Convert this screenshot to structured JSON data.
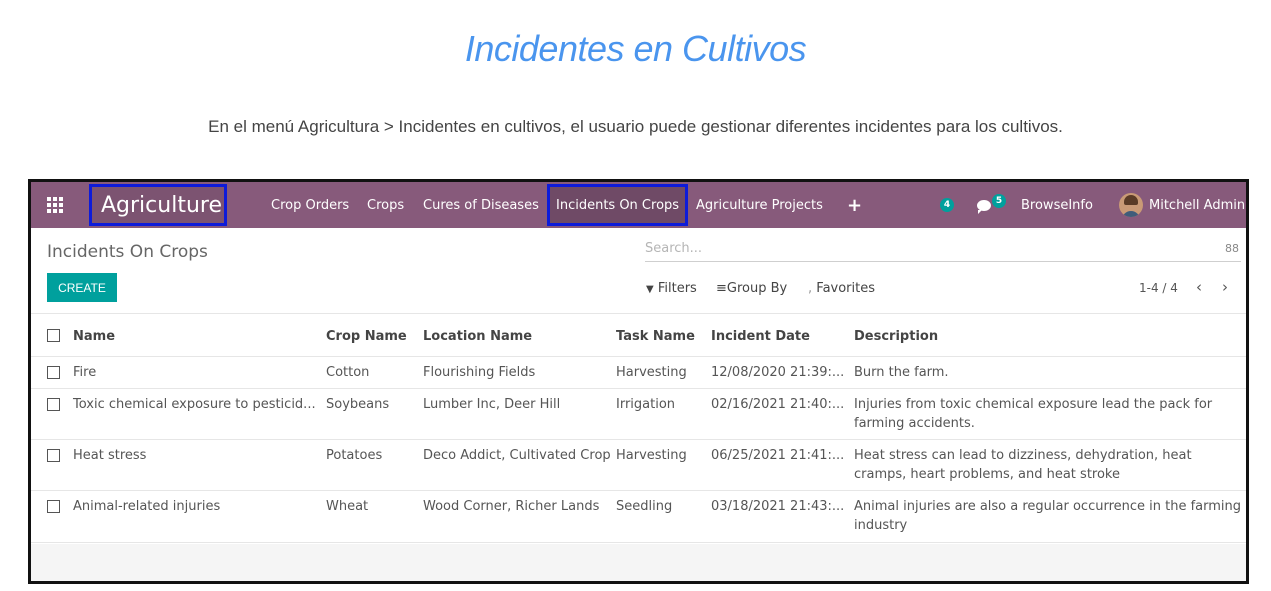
{
  "doc": {
    "title": "Incidentes en Cultivos",
    "description": "En el menú Agricultura > Incidentes en cultivos, el usuario puede gestionar diferentes incidentes para los cultivos."
  },
  "navbar": {
    "brand": "Agriculture",
    "menu": [
      "Crop Orders",
      "Crops",
      "Cures of Diseases",
      "Incidents On Crops",
      "Agriculture Projects"
    ],
    "activities_count": "4",
    "messages_count": "5",
    "company": "BrowseInfo",
    "user": "Mitchell Admin",
    "icons": [
      "apps-grid-icon",
      "plus-icon",
      "activity-icon",
      "chat-icon",
      "avatar"
    ]
  },
  "control_panel": {
    "title": "Incidents On Crops",
    "search_placeholder": "Search...",
    "create_label": "CREATE",
    "filters_label": "Filters",
    "groupby_label": "Group By",
    "favorites_label": "Favorites",
    "pager": "1-4 / 4"
  },
  "table": {
    "columns": [
      "Name",
      "Crop Name",
      "Location Name",
      "Task Name",
      "Incident Date",
      "Description"
    ],
    "rows": [
      {
        "name": "Fire",
        "crop": "Cotton",
        "location": "Flourishing Fields",
        "task": "Harvesting",
        "date": "12/08/2020 21:39:...",
        "desc": "Burn the farm."
      },
      {
        "name": "Toxic chemical exposure to pesticid...",
        "crop": "Soybeans",
        "location": "Lumber Inc, Deer Hill",
        "task": "Irrigation",
        "date": "02/16/2021 21:40:...",
        "desc": "Injuries from toxic chemical exposure lead the pack for farming accidents."
      },
      {
        "name": "Heat stress",
        "crop": "Potatoes",
        "location": "Deco Addict, Cultivated Crop",
        "task": "Harvesting",
        "date": "06/25/2021 21:41:...",
        "desc": "Heat stress can lead to dizziness, dehydration, heat cramps, heart problems, and heat stroke"
      },
      {
        "name": "Animal-related injuries",
        "crop": "Wheat",
        "location": "Wood Corner, Richer Lands",
        "task": "Seedling",
        "date": "03/18/2021 21:43:...",
        "desc": "Animal injuries are also a regular occurrence in the farming industry"
      }
    ]
  }
}
